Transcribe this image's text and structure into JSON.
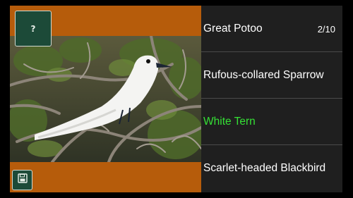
{
  "quiz": {
    "hint_label": "?",
    "counter": "2/10",
    "options": [
      {
        "label": "Great Potoo"
      },
      {
        "label": "Rufous-collared Sparrow"
      },
      {
        "label": "White Tern"
      },
      {
        "label": "Scarlet-headed Blackbird"
      }
    ],
    "highlighted_option_index": 2
  },
  "icons": {
    "save": "floppy-disk-icon",
    "hint": "question-mark"
  },
  "colors": {
    "band": "#b65c0b",
    "button_bg": "#1c4a38",
    "panel_bg": "#1f1f1f",
    "correct_text": "#35e035",
    "text": "#ffffff"
  }
}
